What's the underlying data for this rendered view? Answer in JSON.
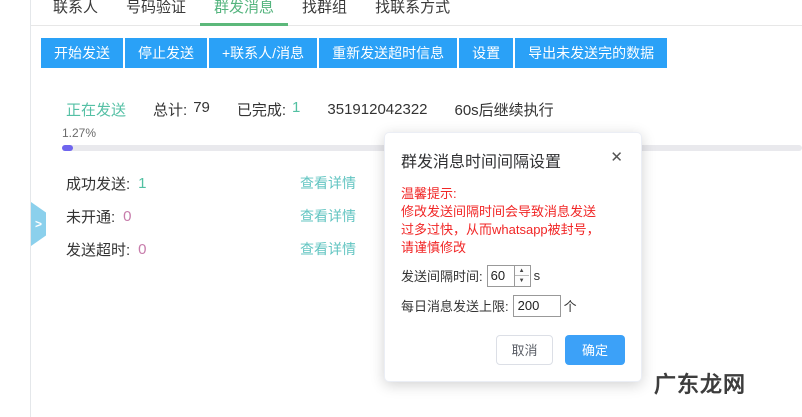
{
  "tabs": [
    {
      "label": "联系人",
      "active": false
    },
    {
      "label": "号码验证",
      "active": false
    },
    {
      "label": "群发消息",
      "active": true
    },
    {
      "label": "找群组",
      "active": false
    },
    {
      "label": "找联系方式",
      "active": false
    }
  ],
  "toolbar": {
    "buttons": [
      {
        "label": "开始发送"
      },
      {
        "label": "停止发送"
      },
      {
        "label": "+联系人/消息"
      },
      {
        "label": "重新发送超时信息"
      },
      {
        "label": "设置"
      },
      {
        "label": "导出未发送完的数据"
      }
    ]
  },
  "status": {
    "sending_label": "正在发送",
    "total_label": "总计:",
    "total_value": "79",
    "completed_label": "已完成:",
    "completed_value": "1",
    "current_number": "351912042322",
    "countdown": "60s后继续执行",
    "progress_percent": "1.27%"
  },
  "stats": [
    {
      "label": "成功发送:",
      "value": "1",
      "link": "查看详情"
    },
    {
      "label": "未开通:",
      "value": "0",
      "link": "查看详情"
    },
    {
      "label": "发送超时:",
      "value": "0",
      "link": "查看详情"
    }
  ],
  "modal": {
    "title": "群发消息时间间隔设置",
    "warning_line1": "温馨提示:",
    "warning_line2": "修改发送间隔时间会导致消息发送",
    "warning_line3": "过多过快，从而whatsapp被封号，",
    "warning_line4": "请谨慎修改",
    "interval_label": "发送间隔时间:",
    "interval_value": "60",
    "interval_unit": "s",
    "daily_limit_label": "每日消息发送上限:",
    "daily_limit_value": "200",
    "daily_limit_unit": "个",
    "cancel_label": "取消",
    "confirm_label": "确定"
  },
  "icons": {
    "close": "✕",
    "collapse": ">",
    "spin_up": "▲",
    "spin_down": "▼"
  },
  "watermark": {
    "text": "广东龙网"
  },
  "colors": {
    "toolbar_blue": "#2aa1f7",
    "tab_active_green": "#54b47e",
    "status_teal": "#55c0a5",
    "link_teal": "#63c5c2",
    "zero_pink": "#c77cab",
    "warning_red": "#f12626",
    "progress_fill": "#6f65ee",
    "confirm_blue": "#3ca1f8"
  }
}
